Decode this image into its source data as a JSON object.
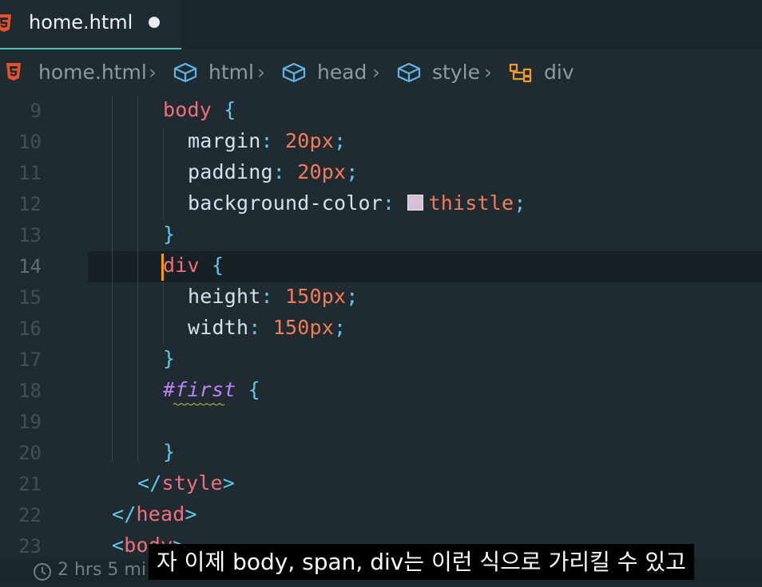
{
  "tab": {
    "label": "home.html"
  },
  "breadcrumb": [
    "home.html",
    "html",
    "head",
    "style",
    "div"
  ],
  "lines": [
    {
      "num": "9",
      "tokens": [
        {
          "t": "body",
          "c": "sel"
        },
        {
          "t": " ",
          "c": ""
        },
        {
          "t": "{",
          "c": "pun"
        }
      ]
    },
    {
      "num": "10",
      "tokens": [
        {
          "t": "margin",
          "c": "prop"
        },
        {
          "t": ": ",
          "c": "pun"
        },
        {
          "t": "20px",
          "c": "num"
        },
        {
          "t": ";",
          "c": "pun"
        }
      ]
    },
    {
      "num": "11",
      "tokens": [
        {
          "t": "padding",
          "c": "prop"
        },
        {
          "t": ": ",
          "c": "pun"
        },
        {
          "t": "20px",
          "c": "num"
        },
        {
          "t": ";",
          "c": "pun"
        }
      ]
    },
    {
      "num": "12",
      "tokens": [
        {
          "t": "background-color",
          "c": "prop"
        },
        {
          "t": ": ",
          "c": "pun"
        },
        {
          "t": "thistle",
          "c": "kw",
          "swatch": true
        },
        {
          "t": ";",
          "c": "pun"
        }
      ]
    },
    {
      "num": "13",
      "tokens": [
        {
          "t": "}",
          "c": "pun"
        }
      ]
    },
    {
      "num": "14",
      "tokens": [
        {
          "t": "div",
          "c": "sel"
        },
        {
          "t": " ",
          "c": ""
        },
        {
          "t": "{",
          "c": "pun"
        }
      ]
    },
    {
      "num": "15",
      "tokens": [
        {
          "t": "height",
          "c": "prop"
        },
        {
          "t": ": ",
          "c": "pun"
        },
        {
          "t": "150px",
          "c": "num"
        },
        {
          "t": ";",
          "c": "pun"
        }
      ]
    },
    {
      "num": "16",
      "tokens": [
        {
          "t": "width",
          "c": "prop"
        },
        {
          "t": ": ",
          "c": "pun"
        },
        {
          "t": "150px",
          "c": "num"
        },
        {
          "t": ";",
          "c": "pun"
        }
      ]
    },
    {
      "num": "17",
      "tokens": [
        {
          "t": "}",
          "c": "pun"
        }
      ]
    },
    {
      "num": "18",
      "tokens": [
        {
          "t": "#first",
          "c": "idsel"
        },
        {
          "t": " ",
          "c": ""
        },
        {
          "t": "{",
          "c": "pun"
        }
      ]
    },
    {
      "num": "19",
      "tokens": []
    },
    {
      "num": "20",
      "tokens": [
        {
          "t": "}",
          "c": "pun"
        }
      ]
    },
    {
      "num": "21",
      "tokens": [
        {
          "t": "</",
          "c": "brk"
        },
        {
          "t": "style",
          "c": "tag"
        },
        {
          "t": ">",
          "c": "brk"
        }
      ]
    },
    {
      "num": "22",
      "tokens": [
        {
          "t": "</",
          "c": "brk"
        },
        {
          "t": "head",
          "c": "tag"
        },
        {
          "t": ">",
          "c": "brk"
        }
      ]
    },
    {
      "num": "23",
      "tokens": [
        {
          "t": "<",
          "c": "brk"
        },
        {
          "t": "body",
          "c": "tag"
        },
        {
          "t": ">",
          "c": "brk"
        }
      ]
    }
  ],
  "status": {
    "text": "2 hrs 5 mi"
  },
  "subtitle": "자 이제 body, span, div는 이런 식으로 가리킬 수 있고"
}
